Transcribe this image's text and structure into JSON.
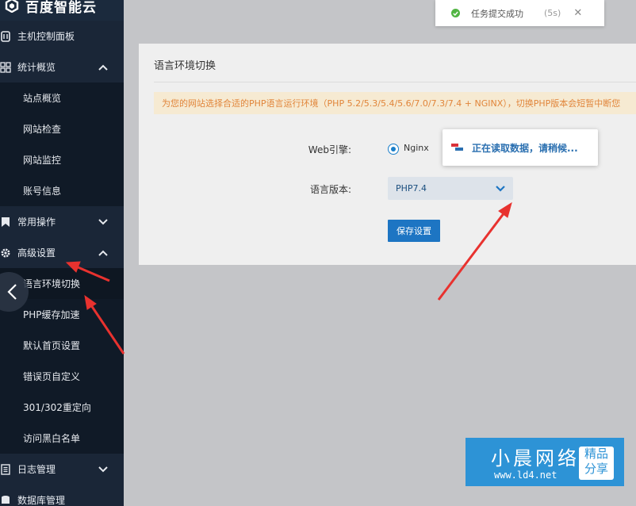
{
  "brand": {
    "name": "百度智能云"
  },
  "sidebar": {
    "items": [
      {
        "label": "主机控制面板",
        "icon": "server-icon"
      },
      {
        "label": "统计概览",
        "icon": "grid-icon",
        "chevron": "up"
      },
      {
        "label": "站点概览"
      },
      {
        "label": "网站检查"
      },
      {
        "label": "网站监控"
      },
      {
        "label": "账号信息"
      },
      {
        "label": "常用操作",
        "icon": "bookmark-icon",
        "chevron": "down"
      },
      {
        "label": "高级设置",
        "icon": "gear-icon",
        "chevron": "up"
      },
      {
        "label": "语言环境切换"
      },
      {
        "label": "PHP缓存加速"
      },
      {
        "label": "默认首页设置"
      },
      {
        "label": "错误页自定义"
      },
      {
        "label": "301/302重定向"
      },
      {
        "label": "访问黑白名单"
      },
      {
        "label": "日志管理",
        "icon": "list-icon",
        "chevron": "down"
      },
      {
        "label": "数据库管理",
        "icon": "database-icon"
      }
    ]
  },
  "panel": {
    "title": "语言环境切换",
    "notice": "为您的网站选择合适的PHP语言运行环境（PHP 5.2/5.3/5.4/5.6/7.0/7.3/7.4 + NGINX），切换PHP版本会短暂中断您",
    "web_engine_label": "Web引擎:",
    "web_engine_value": "Nginx",
    "lang_version_label": "语言版本:",
    "lang_version_value": "PHP7.4",
    "save_label": "保存设置"
  },
  "loading": {
    "text": "正在读取数据，请稍候..."
  },
  "toast": {
    "text": "任务提交成功",
    "countdown": "(5s)",
    "close": "✕"
  },
  "watermark": {
    "title": "小晨网络",
    "url": "www.ld4.net",
    "tag_line1": "精品",
    "tag_line2": "分享"
  },
  "colors": {
    "sidebar_bg": "#1b2a3d",
    "primary": "#1d75c3",
    "notice_text": "#e1853a",
    "arrow": "#e8322f",
    "success": "#52b544"
  }
}
